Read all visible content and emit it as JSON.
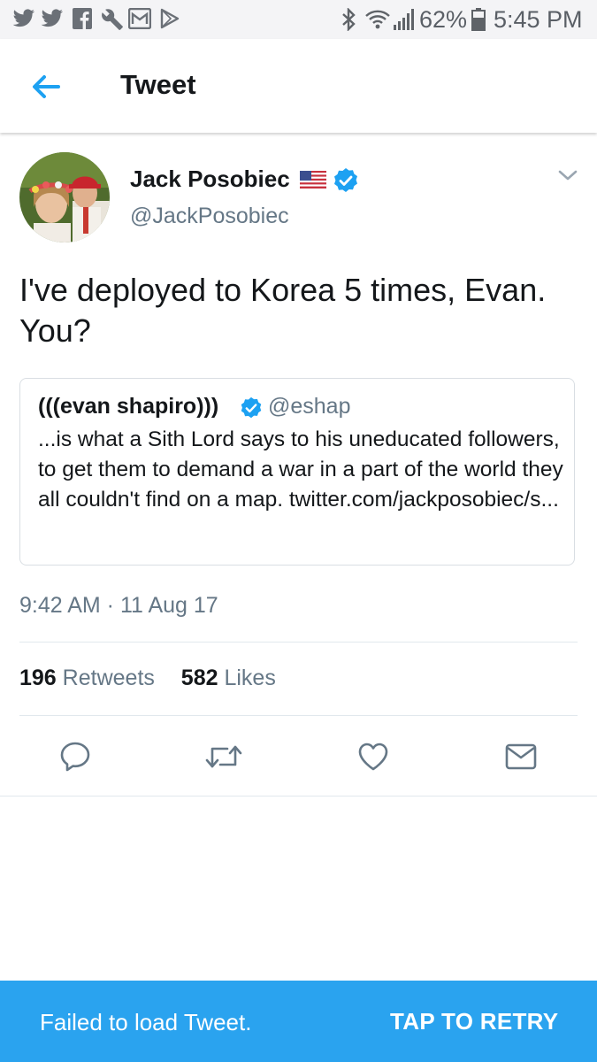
{
  "status_bar": {
    "left_icons": [
      "twitter-icon",
      "twitter-icon",
      "facebook-icon",
      "wrench-icon",
      "gmail-icon",
      "play-store-icon"
    ],
    "battery": "62%",
    "time": "5:45 PM"
  },
  "app_bar": {
    "back_icon": "arrow-left-icon",
    "title": "Tweet"
  },
  "tweet": {
    "author_name": "Jack Posobiec",
    "author_flag": "us-flag-icon",
    "author_handle": "@JackPosobiec",
    "text": "I've deployed to Korea 5 times, Evan. You?",
    "quoted": {
      "name": "(((evan shapiro)))",
      "handle": "@eshap",
      "text": "...is what a Sith Lord says to his uneducated followers, to get them to demand a war in a part of the world they all couldn't find on a map. twitter.com/jackposobiec/s..."
    },
    "timestamp": "9:42 AM · 11 Aug 17",
    "retweet_count": "196",
    "retweet_label": "Retweets",
    "like_count": "582",
    "like_label": "Likes"
  },
  "actions": [
    "reply-icon",
    "retweet-icon",
    "like-icon",
    "message-icon"
  ],
  "snackbar": {
    "message": "Failed to load Tweet.",
    "action": "TAP TO RETRY"
  },
  "colors": {
    "accent": "#1da1f2",
    "snackbar": "#2aa3ef",
    "text": "#14171a",
    "secondary": "#657786"
  }
}
